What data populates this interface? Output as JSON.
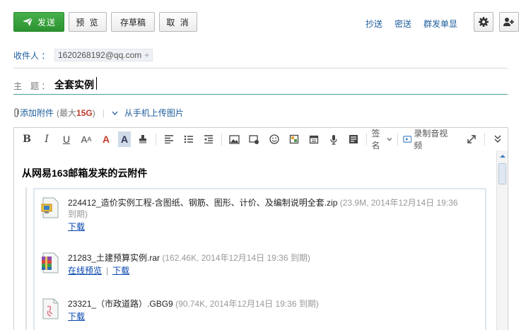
{
  "toolbar": {
    "send_label": "发送",
    "preview_label": "预 览",
    "draft_label": "存草稿",
    "cancel_label": "取 消",
    "cc_label": "抄送",
    "bcc_label": "密送",
    "separate_send_label": "群发单显"
  },
  "recipient": {
    "label": "收件人 ：",
    "chips": [
      "1620268192@qq.com"
    ]
  },
  "subject": {
    "label": "主　题 ：",
    "value": "全套实例"
  },
  "attachment_bar": {
    "add_label": "添加附件",
    "max_prefix": "(最大",
    "max_value": "15G",
    "max_suffix": ")",
    "mobile_upload_label": "从手机上传图片"
  },
  "editor_toolbar": {
    "signature_label": "签名",
    "record_label": "录制音视频"
  },
  "body": {
    "title": "从网易163邮箱发来的云附件",
    "attachments": [
      {
        "name": "224412_造价实例工程-含图纸、钢筋、图形、计价、及编制说明全套.zip",
        "meta": "(23.9M, 2014年12月14日 19:36 到期)",
        "icon": "zip-file-icon",
        "links": [
          "下载"
        ]
      },
      {
        "name": "21283_土建预算实例.rar",
        "meta": "(162.46K, 2014年12月14日  19:36 到期)",
        "icon": "rar-file-icon",
        "links": [
          "在线预览",
          "下载"
        ]
      },
      {
        "name": "23321_（市政道路）.GBG9",
        "meta": "(90.74K, 2014年12月14日  19:36 到期)",
        "icon": "generic-file-icon",
        "links": [
          "下载"
        ]
      }
    ]
  },
  "colors": {
    "send_green": "#2b9230",
    "link_blue": "#1d5d9b",
    "subject_underline": "#4b9c98",
    "size_red": "#c0392b"
  }
}
